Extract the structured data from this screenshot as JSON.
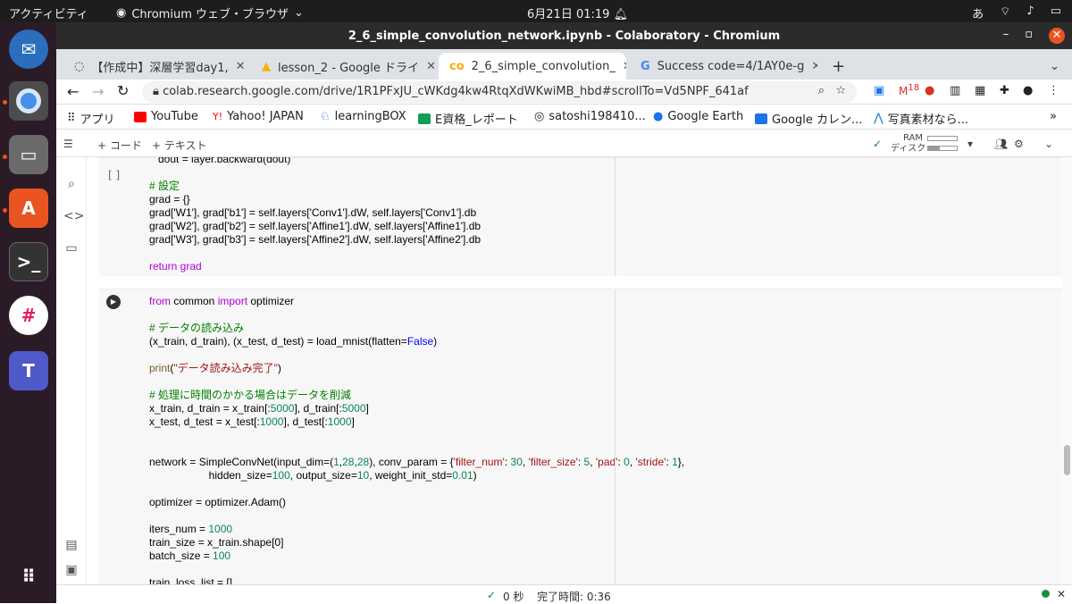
{
  "os": {
    "activities": "アクティビティ",
    "app_name": "Chromium ウェブ・ブラウザ",
    "clock": "6月21日 01:19",
    "input_method": "あ"
  },
  "window": {
    "title": "2_6_simple_convolution_network.ipynb - Colaboratory - Chromium"
  },
  "tabs": [
    {
      "label": "【作成中】深層学習day1,"
    },
    {
      "label": "lesson_2 - Google ドライ"
    },
    {
      "label": "2_6_simple_convolution_"
    },
    {
      "label": "Success code=4/1AY0e-g"
    }
  ],
  "address": {
    "url": "colab.research.google.com/drive/1R1PFxJU_cWKdg4kw4RtqXdWKwiMB_hbd#scrollTo=Vd5NPF_641af"
  },
  "bookmarks": [
    {
      "label": "アプリ"
    },
    {
      "label": "YouTube"
    },
    {
      "label": "Yahoo! JAPAN"
    },
    {
      "label": "learningBOX"
    },
    {
      "label": "E資格_レポート"
    },
    {
      "label": "satoshi198410..."
    },
    {
      "label": "Google Earth"
    },
    {
      "label": "Google カレン..."
    },
    {
      "label": "写真素材なら..."
    }
  ],
  "badge": "18",
  "colab": {
    "add_code": "+ コード",
    "add_text": "+ テキスト",
    "ram": "RAM",
    "disk": "ディスク"
  },
  "cell1": {
    "bracket": "[ ]",
    "lines": {
      "l0": "dout = layer.backward(dout)",
      "l1": "# 設定",
      "l2": "grad = {}",
      "l3": "grad['W1'], grad['b1'] = self.layers['Conv1'].dW, self.layers['Conv1'].db",
      "l4": "grad['W2'], grad['b2'] = self.layers['Affine1'].dW, self.layers['Affine1'].db",
      "l5": "grad['W3'], grad['b3'] = self.layers['Affine2'].dW, self.layers['Affine2'].db",
      "l6": "return grad"
    }
  },
  "cell2": {
    "lines": {
      "a1": "from",
      "a2": " common ",
      "a3": "import",
      "a4": " optimizer",
      "b": "# データの読み込み",
      "c1": "(x_train, d_train), (x_test, d_test) = load_mnist(flatten=",
      "c2": "False",
      "c3": ")",
      "d1": "print",
      "d2": "(",
      "d3": "\"データ読み込み完了\"",
      "d4": ")",
      "e": "# 処理に時間のかかる場合はデータを削減",
      "f1": "x_train, d_train = x_train[:",
      "f2": "5000",
      "f3": "], d_train[:",
      "f4": "5000",
      "f5": "]",
      "g1": "x_test, d_test = x_test[:",
      "g2": "1000",
      "g3": "], d_test[:",
      "g4": "1000",
      "g5": "]",
      "h1": "network = SimpleConvNet(input_dim=(",
      "h2": "1",
      "h3": ",",
      "h4": "28",
      "h5": ",",
      "h6": "28",
      "h7": "), conv_param = {",
      "h8": "'filter_num'",
      "h9": ": ",
      "h10": "30",
      "h11": ", ",
      "h12": "'filter_size'",
      "h13": ": ",
      "h14": "5",
      "h15": ", ",
      "h16": "'pad'",
      "h17": ": ",
      "h18": "0",
      "h19": ", ",
      "h20": "'stride'",
      "h21": ": ",
      "h22": "1",
      "h23": "},",
      "i1": "                    hidden_size=",
      "i2": "100",
      "i3": ", output_size=",
      "i4": "10",
      "i5": ", weight_init_std=",
      "i6": "0.01",
      "i7": ")",
      "j": "optimizer = optimizer.Adam()",
      "k1": "iters_num = ",
      "k2": "1000",
      "l": "train_size = x_train.shape[0]",
      "m1": "batch_size = ",
      "m2": "100",
      "n": "train_loss_list = []"
    }
  },
  "status": {
    "time": "0 秒",
    "done": "完了時間: 0:36"
  }
}
